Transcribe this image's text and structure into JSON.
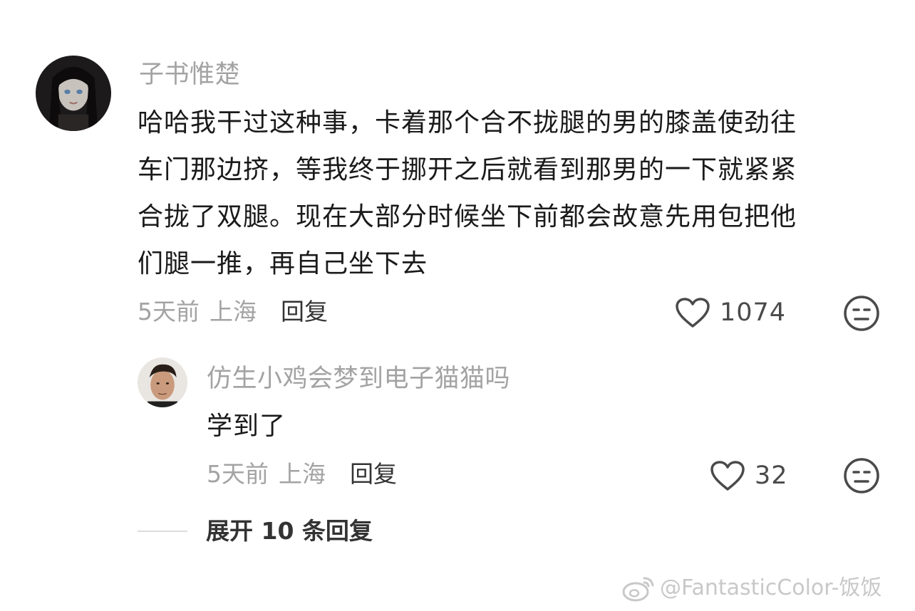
{
  "comments": [
    {
      "username": "子书惟楚",
      "lines": [
        "哈哈我干过这种事，卡着那个合不拢腿的男的膝盖使劲往",
        "车门那边挤，等我终于挪开之后就看到那男的一下就紧紧",
        "合拢了双腿。现在大部分时候坐下前都会故意先用包把他",
        "们腿一推，再自己坐下去"
      ],
      "time": "5天前",
      "location": "上海",
      "reply_label": "回复",
      "likes": "1074",
      "avatar_icon": "avatar-doll"
    }
  ],
  "reply": {
    "username": "仿生小鸡会梦到电子猫猫吗",
    "text": "学到了",
    "time": "5天前",
    "location": "上海",
    "reply_label": "回复",
    "likes": "32",
    "avatar_icon": "avatar-man"
  },
  "expand": {
    "label": "展开 10 条回复"
  },
  "watermark": {
    "text": "@FantasticColor-饭饭",
    "icon": "weibo-icon"
  },
  "icons": {
    "like": "heart-outline-icon",
    "emoji": "neutral-face-icon"
  },
  "colors": {
    "username": "#a3a3a3",
    "text": "#1a1a1a",
    "meta": "#a3a3a3",
    "reply": "#333333",
    "icon": "#4a4a4a"
  }
}
